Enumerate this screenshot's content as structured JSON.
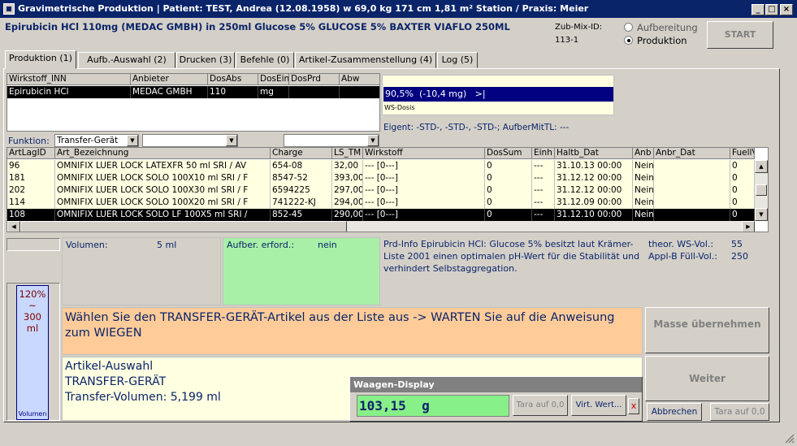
{
  "window": {
    "title": "Gravimetrische Produktion  |  Patient: TEST, Andrea (12.08.1958) w 69,0 kg  171 cm  1,81 m² Station / Praxis: Meier"
  },
  "header": {
    "drug_line": "Epirubicin HCl 110mg (MEDAC GMBH) in 250ml Glucose 5% GLUCOSE 5% BAXTER VIAFLO 250ML",
    "zubmix_label": "Zub-Mix-ID:",
    "zubmix_value": "113-1",
    "radio_aufbereitung": "Aufbereitung",
    "radio_produktion": "Produktion",
    "start_label": "START"
  },
  "tabs": [
    {
      "label": "Produktion (1)"
    },
    {
      "label": "Aufb.-Auswahl (2)"
    },
    {
      "label": "Drucken (3)"
    },
    {
      "label": "Befehle (0)"
    },
    {
      "label": "Artikel-Zusammenstellung (4)"
    },
    {
      "label": "Log (5)"
    }
  ],
  "wirkstoff": {
    "headers": [
      "Wirkstoff_INN",
      "Anbieter",
      "DosAbs",
      "DosEinh",
      "DosPrd",
      "Abw"
    ],
    "row": [
      "Epirubicin HCl",
      "MEDAC GMBH",
      "110",
      "mg",
      "",
      ""
    ]
  },
  "dosis": {
    "bar_text": "90,5%  (-10,4 mg)   >|",
    "label": "WS-Dosis",
    "eigent": "Eigent: -STD-, -STD-, -STD-; AufberMitTL: ---"
  },
  "funktion": {
    "label": "Funktion:",
    "value": "Transfer-Gerät"
  },
  "articles": {
    "headers": [
      "ArtLagID",
      "Art_Bezeichnung",
      "Charge",
      "LS_TM",
      "Wirkstoff",
      "DosSum",
      "Einh",
      "Haltb_Dat",
      "Anb",
      "Anbr_Dat",
      "FuellV"
    ],
    "rows": [
      [
        "96",
        "OMNIFIX LUER LOCK LATEXFR   50 ml SRI  / AV",
        "654-08",
        "32,00",
        "--- [0---]",
        "0",
        "---",
        "31.10.13 00:00",
        "Nein",
        "",
        "0"
      ],
      [
        "181",
        "OMNIFIX LUER LOCK SOLO    100X10 ml SRI  / F",
        "8547-52",
        "393,00",
        "--- [0---]",
        "0",
        "---",
        "31.12.12 00:00",
        "Nein",
        "",
        "0"
      ],
      [
        "202",
        "OMNIFIX LUER LOCK SOLO    100X30 ml SRI  / F",
        "6594225",
        "297,00",
        "--- [0---]",
        "0",
        "---",
        "31.12.12 00:00",
        "Nein",
        "",
        "0"
      ],
      [
        "114",
        "OMNIFIX LUER LOCK SOLO    100X20 ml SRI  / F",
        "741222-KJ",
        "294,00",
        "--- [0---]",
        "0",
        "---",
        "31.12.09 00:00",
        "Nein",
        "",
        "0"
      ],
      [
        "108",
        "OMNIFIX LUER LOCK SOLO LF    100X5 ml SRI  /",
        "852-45",
        "290,00",
        "--- [0---]",
        "0",
        "---",
        "31.12.10 00:00",
        "Nein",
        "",
        "0"
      ]
    ]
  },
  "details": {
    "volumen_label": "Volumen:",
    "volumen_value": "5 ml",
    "aufber_label": "Aufber. erford.:",
    "aufber_value": "nein",
    "prdinfo": "Prd-Info Epirubicin HCl: Glucose 5% besitzt laut Krämer-Liste 2001 einen optimalen pH-Wert für die Stabilität und verhindert Selbstaggregation.",
    "theor_label": "theor. WS-Vol.:",
    "theor_value": "55",
    "applb_label": "Appl-B Füll-Vol.:",
    "applb_value": "250"
  },
  "volume_gauge": {
    "pct": "120%",
    "tilde": "~",
    "ml": "300",
    "unit": "ml",
    "label": "Volumen",
    "level": 1.0,
    "color": "#c8d8ff"
  },
  "instruction": "Wählen Sie den TRANSFER-GERÄT-Artikel aus der Liste aus -> WARTEN Sie auf die Anweisung zum WIEGEN",
  "article_info": {
    "line1": "Artikel-Auswahl",
    "line2": "TRANSFER-GERÄT",
    "line3": "Transfer-Volumen: 5,199 ml"
  },
  "waagen": {
    "title": "Waagen-Display",
    "value": "103,15  g",
    "tara_label": "Tara auf 0,0",
    "virt_label": "Virt. Wert...",
    "close_label": "x"
  },
  "buttons": {
    "masse": "Masse übernehmen",
    "weiter": "Weiter",
    "abbrechen": "Abbrechen",
    "tara": "Tara auf 0,0"
  },
  "colors": {
    "titlebar": "#0a246a",
    "dosis_bar": "#000080",
    "aufber_bg": "#a8f0a8",
    "instruction_bg": "#ffcc99",
    "info_bg": "#ffffe1",
    "waagen_value_bg": "#88f088"
  }
}
